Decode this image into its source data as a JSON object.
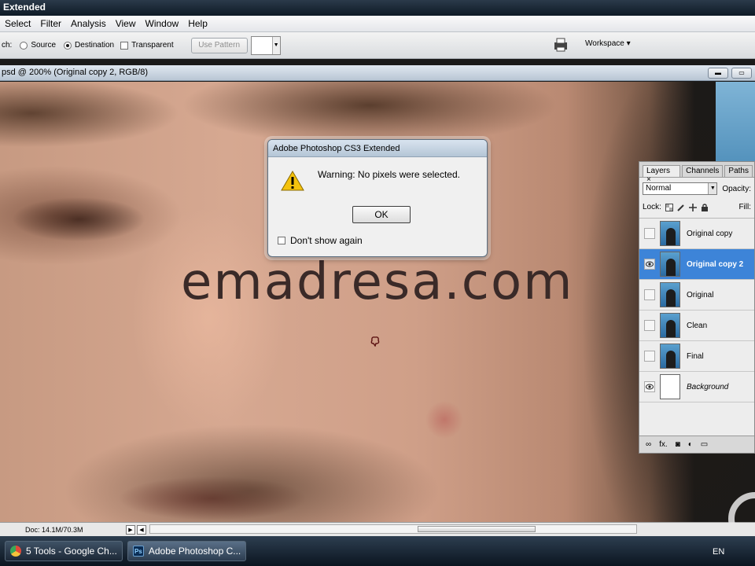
{
  "app": {
    "title": "Extended"
  },
  "menu": [
    "Select",
    "Filter",
    "Analysis",
    "View",
    "Window",
    "Help"
  ],
  "options": {
    "patch_label": "ch:",
    "source_label": "Source",
    "destination_label": "Destination",
    "transparent_label": "Transparent",
    "use_pattern_label": "Use Pattern",
    "workspace_label": "Workspace ▾",
    "selected_mode": "Destination"
  },
  "document": {
    "title": "psd @ 200% (Original copy 2, RGB/8)"
  },
  "canvas": {
    "watermark": "emadresa.com"
  },
  "dialog": {
    "title": "Adobe Photoshop CS3 Extended",
    "message": "Warning: No pixels were selected.",
    "ok_label": "OK",
    "dont_show_label": "Don't show again"
  },
  "layers_panel": {
    "tabs": [
      "Layers ×",
      "Channels",
      "Paths"
    ],
    "blend_mode": "Normal",
    "opacity_label": "Opacity:",
    "lock_label": "Lock:",
    "fill_label": "Fill:",
    "layers": [
      {
        "name": "Original copy",
        "visible": false,
        "selected": false,
        "thumb": "photo"
      },
      {
        "name": "Original copy 2",
        "visible": true,
        "selected": true,
        "thumb": "photo"
      },
      {
        "name": "Original",
        "visible": false,
        "selected": false,
        "thumb": "photo"
      },
      {
        "name": "Clean",
        "visible": false,
        "selected": false,
        "thumb": "photo"
      },
      {
        "name": "Final",
        "visible": false,
        "selected": false,
        "thumb": "photo"
      },
      {
        "name": "Background",
        "visible": true,
        "selected": false,
        "thumb": "white",
        "italic": true
      }
    ],
    "footer_icons": [
      "link-icon",
      "fx-icon",
      "mask-icon",
      "adjustment-icon",
      "group-icon"
    ],
    "footer_fx": "fx."
  },
  "status": {
    "doc_info": "Doc: 14.1M/70.3M"
  },
  "taskbar": {
    "items": [
      {
        "label": "5 Tools - Google Ch...",
        "icon": "chrome-icon"
      },
      {
        "label": "Adobe Photoshop C...",
        "icon": "photoshop-icon"
      }
    ],
    "language": "EN"
  },
  "colors": {
    "selection_blue": "#3d84d8",
    "taskbar": "#0b1520"
  }
}
